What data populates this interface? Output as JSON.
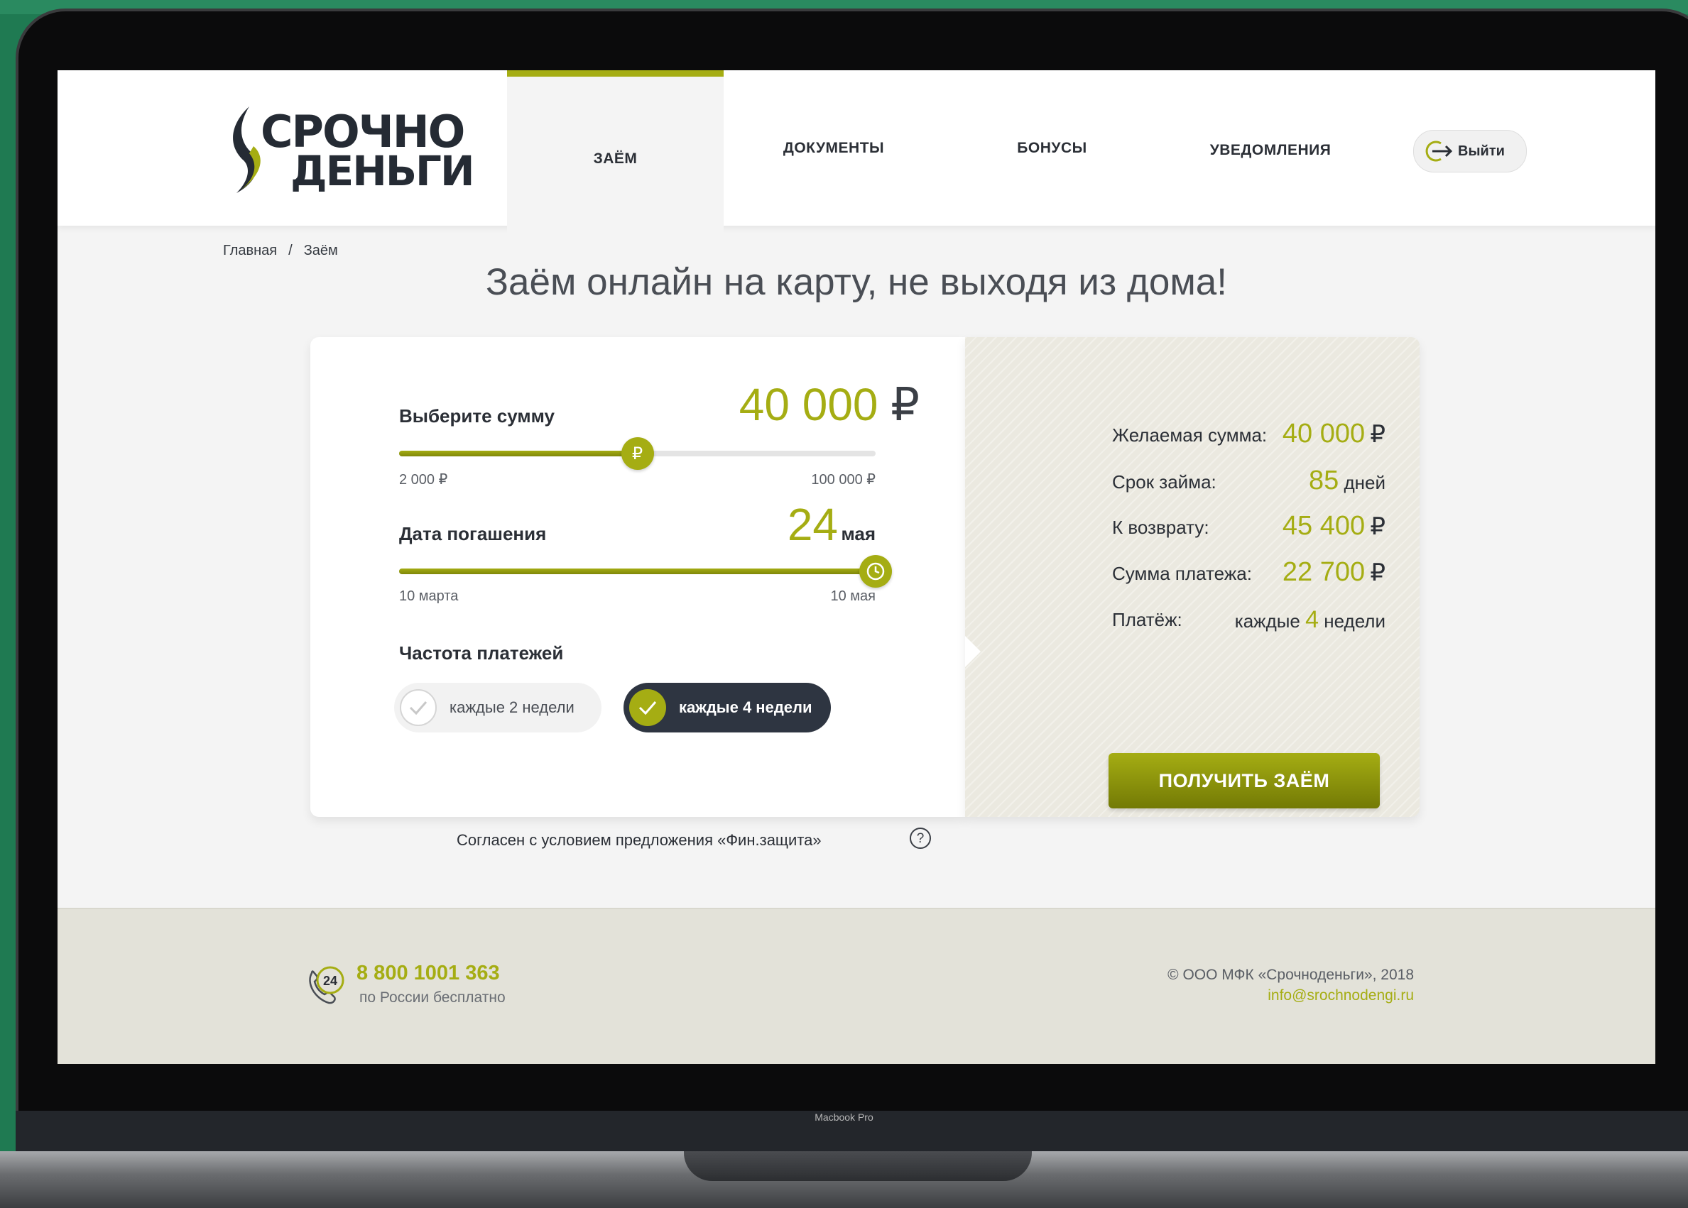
{
  "device": {
    "label": "Macbook Pro"
  },
  "header": {
    "logo_line1": "СРОЧНО",
    "logo_line2": "ДЕНЬГИ",
    "nav": [
      {
        "label": "ЗАЁМ",
        "active": true
      },
      {
        "label": "ДОКУМЕНТЫ",
        "active": false
      },
      {
        "label": "БОНУСЫ",
        "active": false
      },
      {
        "label": "УВЕДОМЛЕНИЯ",
        "active": false
      }
    ],
    "logout_label": "Выйти"
  },
  "breadcrumb": {
    "home": "Главная",
    "separator": "/",
    "current": "Заём"
  },
  "page_title": "Заём онлайн на карту, не выходя из дома!",
  "calculator": {
    "amount": {
      "label": "Выберите сумму",
      "value": "40 000",
      "currency": "₽",
      "min_label": "2 000 ₽",
      "max_label": "100 000 ₽",
      "fraction": 0.5,
      "thumb_glyph": "₽"
    },
    "date": {
      "label": "Дата погашения",
      "day": "24",
      "month": "мая",
      "min_label": "10 марта",
      "max_label": "10 мая",
      "fraction": 1.0
    },
    "frequency": {
      "label": "Частота платежей",
      "options": [
        {
          "label": "каждые 2 недели",
          "selected": false
        },
        {
          "label": "каждые 4 недели",
          "selected": true
        }
      ]
    },
    "agreement_text": "Согласен с условием предложения «Фин.защита»",
    "help_glyph": "?"
  },
  "summary": {
    "rows": [
      {
        "label": "Желаемая сумма:",
        "prefix": "",
        "value": "40 000",
        "unit": "₽"
      },
      {
        "label": "Срок займа:",
        "prefix": "",
        "value": "85",
        "unit": "дней"
      },
      {
        "label": "К возврату:",
        "prefix": "",
        "value": "45 400",
        "unit": "₽"
      },
      {
        "label": "Сумма платежа:",
        "prefix": "",
        "value": "22 700",
        "unit": "₽"
      },
      {
        "label": "Платёж:",
        "prefix": "каждые",
        "value": "4",
        "unit": "недели"
      }
    ],
    "cta_label": "ПОЛУЧИТЬ ЗАЁМ"
  },
  "footer": {
    "phone": "8 800 1001 363",
    "phone_sub": "по России бесплатно",
    "phone_badge": "24",
    "copyright": "© ООО МФК «Срочноденьги», 2018",
    "email": "info@srochnodengi.ru"
  },
  "colors": {
    "accent": "#a5ad13",
    "dark": "#2e3541",
    "summary_bg": "#ebe9e0",
    "footer_bg": "#e3e2d9"
  },
  "icons": [
    "logo-swoosh-icon",
    "logout-icon",
    "ruble-icon",
    "clock-icon",
    "check-icon",
    "question-icon",
    "phone-24-icon"
  ]
}
